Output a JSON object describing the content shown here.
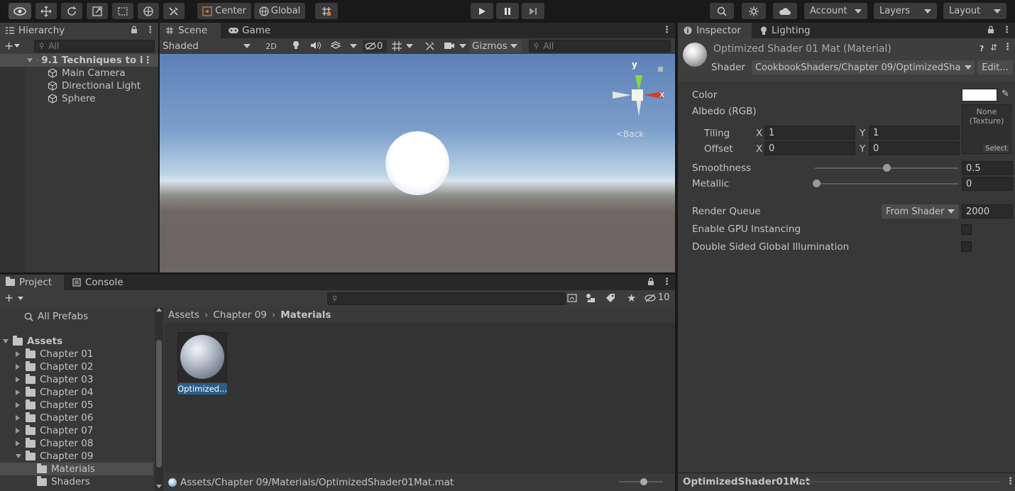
{
  "toolbar": {
    "pivot_label": "Center",
    "space_label": "Global",
    "account_label": "Account",
    "layers_label": "Layers",
    "layout_label": "Layout"
  },
  "hierarchy": {
    "tab": "Hierarchy",
    "search_placeholder": "All",
    "scene_name": "9.1 Techniques to i",
    "items": [
      "Main Camera",
      "Directional Light",
      "Sphere"
    ]
  },
  "scene": {
    "tabs": [
      "Scene",
      "Game"
    ],
    "shading_mode": "Shaded",
    "mode_2d": "2D",
    "hidden_count": "0",
    "gizmos_label": "Gizmos",
    "search_placeholder": "All",
    "gizmo_y": "y",
    "gizmo_x": "x",
    "view_label": "Back"
  },
  "inspector": {
    "tabs": [
      "Inspector",
      "Lighting"
    ],
    "title": "Optimized Shader 01 Mat (Material)",
    "shader_label": "Shader",
    "shader_value": "CookbookShaders/Chapter 09/OptimizedSha",
    "edit_label": "Edit...",
    "color_label": "Color",
    "albedo_label": "Albedo (RGB)",
    "texture_none": "None",
    "texture_type": "(Texture)",
    "texture_select": "Select",
    "tiling_label": "Tiling",
    "offset_label": "Offset",
    "x_label": "X",
    "y_label": "Y",
    "tiling_x": "1",
    "tiling_y": "1",
    "offset_x": "0",
    "offset_y": "0",
    "smoothness_label": "Smoothness",
    "smoothness_value": "0.5",
    "smoothness_fraction": 0.5,
    "metallic_label": "Metallic",
    "metallic_value": "0",
    "metallic_fraction": 0.0,
    "render_queue_label": "Render Queue",
    "render_queue_mode": "From Shader",
    "render_queue_value": "2000",
    "gpu_instancing_label": "Enable GPU Instancing",
    "double_sided_label": "Double Sided Global Illumination",
    "footer_name": "OptimizedShader01Mat"
  },
  "project": {
    "tabs": [
      "Project",
      "Console"
    ],
    "hidden_count": "10",
    "all_prefabs": "All Prefabs",
    "assets_label": "Assets",
    "folders": [
      "Chapter 01",
      "Chapter 02",
      "Chapter 03",
      "Chapter 04",
      "Chapter 05",
      "Chapter 06",
      "Chapter 07",
      "Chapter 08",
      "Chapter 09"
    ],
    "subfolders": [
      "Materials",
      "Shaders"
    ],
    "breadcrumb": [
      "Assets",
      "Chapter 09",
      "Materials"
    ],
    "asset_name": "Optimized...",
    "asset_path": "Assets/Chapter 09/Materials/OptimizedShader01Mat.mat"
  }
}
